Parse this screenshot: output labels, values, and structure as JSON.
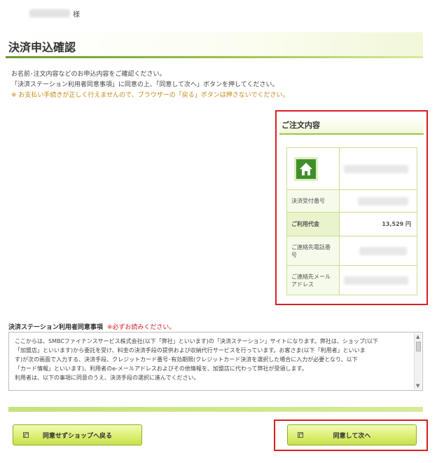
{
  "header": {
    "honorific": "様"
  },
  "page": {
    "title": "決済申込確認"
  },
  "intro": {
    "line1": "お名前･注文内容などのお申込内容をご確認ください。",
    "line2": "「決済ステーション利用者同意事項」に同意の上、「同意して次へ」ボタンを押してください。",
    "warning": "※ お支払い手続きが正しく行えませんので、ブラウザーの「戻る」ボタンは押さないでください。"
  },
  "summary": {
    "title": "ご注文内容",
    "rows": {
      "receipt_no": "決済受付番号",
      "amount_label": "ご利用代金",
      "amount_value": "13,529 円",
      "phone": "ご連絡先電話番号",
      "email": "ご連絡先メールアドレス"
    }
  },
  "agreement": {
    "title": "決済ステーション利用者同意事項",
    "must_read": "※必ずお読みください。",
    "lines": [
      "ここからは、SMBCファイナンスサービス株式会社(以下「弊社」といいます)の「決済ステーション」サイトになります。弊社は、ショップ(以下",
      "「加盟店」といいます)から委託を受け、料金の決済手段の提供および収納代行サービスを行っています。お客さま(以下「利用者」といいま",
      "す)が次の画面で入力する、決済手段、クレジットカード番号･有効期限(クレジットカード決済を選択した場合に入力が必要となり、以下",
      "「カード情報」といいます)、利用者のe-メールアドレスおよびその他情報を、加盟店に代わって弊社が受領します。",
      "利用者は、以下の事項に同意のうえ、決済手段の選択に進んでください。"
    ]
  },
  "buttons": {
    "back": "同意せずショップへ戻る",
    "next": "同意して次へ"
  },
  "colors": {
    "accent_green": "#9cc44a",
    "highlight_red": "#d71f24",
    "amount_red": "#b8182a",
    "warning_orange": "#c08a12"
  }
}
